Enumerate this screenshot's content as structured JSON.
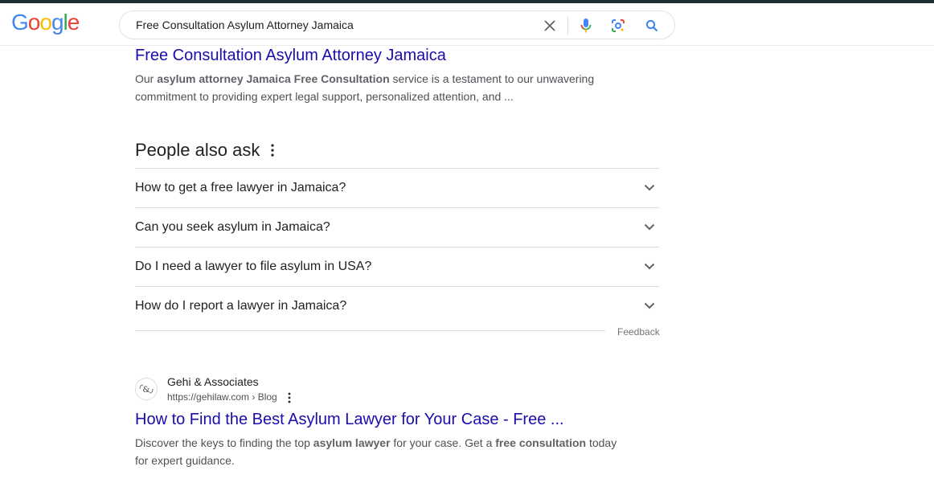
{
  "search": {
    "query": "Free Consultation Asylum Attorney Jamaica",
    "logo_letters": [
      "G",
      "o",
      "o",
      "g",
      "l",
      "e"
    ],
    "logo_colors": [
      "#4285F4",
      "#EA4335",
      "#FBBC05",
      "#4285F4",
      "#34A853",
      "#EA4335"
    ]
  },
  "result1": {
    "title": "Free Consultation Asylum Attorney Jamaica",
    "snippet_line1_pre": "Our ",
    "snippet_line1_bold": "asylum attorney Jamaica Free Consultation",
    "snippet_line1_post": " service is a testament to our unwavering",
    "snippet_line2": "commitment to providing expert legal support, personalized attention, and ..."
  },
  "people_also_ask": {
    "heading": "People also ask",
    "questions": [
      "How to get a free lawyer in Jamaica?",
      "Can you seek asylum in Jamaica?",
      "Do I need a lawyer to file asylum in USA?",
      "How do I report a lawyer in Jamaica?"
    ],
    "feedback_label": "Feedback"
  },
  "result2": {
    "site_name": "Gehi & Associates",
    "url": "https://gehilaw.com › Blog",
    "favicon_text": "G&A",
    "title": "How to Find the Best Asylum Lawyer for Your Case - Free ...",
    "snippet_line1_pre": "Discover the keys to finding the top ",
    "snippet_line1_bold1": "asylum lawyer",
    "snippet_line1_mid": " for your case. Get a ",
    "snippet_line1_bold2": "free consultation",
    "snippet_line1_post": " today",
    "snippet_line2": "for expert guidance."
  },
  "colors": {
    "link": "#1a0dab",
    "snippet": "#4d5156"
  }
}
